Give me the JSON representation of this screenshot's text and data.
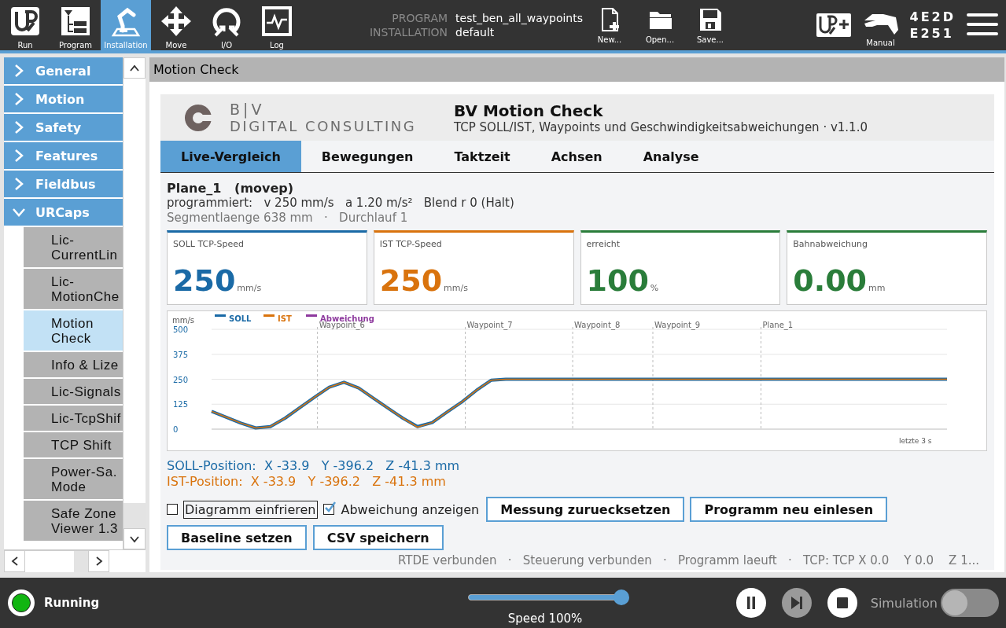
{
  "topbar": {
    "nav": [
      {
        "label": "Run",
        "selected": false
      },
      {
        "label": "Program",
        "selected": false
      },
      {
        "label": "Installation",
        "selected": true
      },
      {
        "label": "Move",
        "selected": false
      },
      {
        "label": "I/O",
        "selected": false
      },
      {
        "label": "Log",
        "selected": false
      }
    ],
    "program": {
      "label": "PROGRAM",
      "value": "test_ben_all_waypoints"
    },
    "installation": {
      "label": "INSTALLATION",
      "value": "default"
    },
    "file_actions": [
      "New...",
      "Open...",
      "Save..."
    ],
    "mode": {
      "label": "Manual"
    },
    "robot_code": [
      "4E2D",
      "E251"
    ]
  },
  "sidebar": {
    "items": [
      {
        "label": "General",
        "expanded": false
      },
      {
        "label": "Motion",
        "expanded": false
      },
      {
        "label": "Safety",
        "expanded": false
      },
      {
        "label": "Features",
        "expanded": false
      },
      {
        "label": "Fieldbus",
        "expanded": false
      },
      {
        "label": "URCaps",
        "expanded": true,
        "children": [
          {
            "label": "Lic-CurrentLin",
            "selected": false
          },
          {
            "label": "Lic-MotionChe",
            "selected": false
          },
          {
            "label": "Motion Check",
            "selected": true
          },
          {
            "label": "Info & Lize",
            "selected": false
          },
          {
            "label": "Lic-Signals",
            "selected": false
          },
          {
            "label": "Lic-TcpShif",
            "selected": false
          },
          {
            "label": "TCP Shift",
            "selected": false
          },
          {
            "label": "Power-Sa. Mode",
            "selected": false
          },
          {
            "label": "Safe Zone Viewer 1.3",
            "selected": false
          }
        ]
      }
    ]
  },
  "panel": {
    "title": "Motion Check"
  },
  "plugin": {
    "logo": {
      "line1": "B|V",
      "line2": "DIGITAL CONSULTING"
    },
    "title": "BV Motion Check",
    "subtitle": "TCP SOLL/IST, Waypoints und Geschwindigkeitsabweichungen · v1.1.0",
    "tabs": [
      {
        "label": "Live-Vergleich",
        "selected": true
      },
      {
        "label": "Bewegungen",
        "selected": false
      },
      {
        "label": "Taktzeit",
        "selected": false
      },
      {
        "label": "Achsen",
        "selected": false
      },
      {
        "label": "Analyse",
        "selected": false
      }
    ],
    "segment": {
      "name": "Plane_1",
      "type": "(movep)",
      "programmed": "programmiert:   v 250 mm/s   a 1.20 m/s²   Blend r 0 (Halt)",
      "info": "Segmentlaenge 638 mm   ·   Durchlauf 1"
    },
    "metrics": [
      {
        "label": "SOLL TCP-Speed",
        "value": "250",
        "unit": "mm/s",
        "color": "#1a6aa6"
      },
      {
        "label": "IST TCP-Speed",
        "value": "250",
        "unit": "mm/s",
        "color": "#d9730d"
      },
      {
        "label": "erreicht",
        "value": "100",
        "unit": "%",
        "color": "#2a7d3a"
      },
      {
        "label": "Bahnabweichung",
        "value": "0.00",
        "unit": "mm",
        "color": "#2a7d3a"
      }
    ],
    "chart": {
      "footnote": "letzte 3 s",
      "waypoints": [
        "Waypoint_6",
        "Waypoint_7",
        "Waypoint_8",
        "Waypoint_9",
        "Plane_1"
      ],
      "chart_data": {
        "type": "line",
        "ylabel": "mm/s",
        "categories": [
          null,
          null,
          null,
          null,
          null,
          null,
          null,
          null,
          null,
          null,
          null,
          null,
          null,
          null,
          null,
          null,
          null,
          null,
          null,
          null,
          null,
          null,
          null,
          null,
          null,
          null,
          null,
          null,
          null,
          null,
          null,
          null,
          null,
          null,
          null,
          null,
          null,
          null,
          null,
          null,
          null,
          null,
          null,
          null,
          null,
          null,
          null,
          null,
          null,
          null,
          null
        ],
        "ylim": [
          0,
          500
        ],
        "yticks": [
          0,
          125,
          250,
          375,
          500
        ],
        "grid": true,
        "legend": "top-left",
        "series": [
          {
            "name": "SOLL",
            "color": "#1a6aa6",
            "values": [
              89,
              60,
              30,
              6,
              13,
              55,
              108,
              160,
              210,
              235,
              206,
              155,
              105,
              55,
              13,
              33,
              85,
              135,
              194,
              245,
              250,
              250,
              250,
              250,
              250,
              250,
              250,
              250,
              250,
              250,
              250,
              250,
              250,
              250,
              250,
              250,
              250,
              250,
              250,
              250,
              250,
              250,
              250,
              250,
              250,
              250,
              250,
              250,
              250,
              250,
              250
            ]
          },
          {
            "name": "IST",
            "color": "#d9730d",
            "values": [
              89,
              60,
              30,
              6,
              13,
              55,
              108,
              160,
              210,
              235,
              206,
              155,
              105,
              55,
              10,
              33,
              85,
              135,
              194,
              245,
              250,
              250,
              250,
              250,
              250,
              250,
              250,
              250,
              250,
              250,
              250,
              250,
              250,
              250,
              250,
              250,
              250,
              250,
              250,
              250,
              250,
              250,
              250,
              250,
              250,
              250,
              250,
              250,
              250,
              250,
              250
            ]
          },
          {
            "name": "Abweichung",
            "color": "#8e3a9e",
            "values": [
              null,
              null,
              null,
              null,
              null,
              null,
              null,
              null,
              null,
              null,
              null,
              null,
              null,
              null,
              null,
              null,
              null,
              null,
              null,
              null,
              null,
              null,
              null,
              null,
              null,
              null,
              null,
              null,
              null,
              null,
              null,
              null,
              null,
              null,
              null,
              null,
              null,
              null,
              null,
              null,
              null,
              null,
              null,
              null,
              null,
              null,
              null,
              null,
              null,
              null,
              null
            ]
          }
        ]
      }
    },
    "positions": [
      {
        "label": "SOLL-Position:",
        "x": "X -33.9",
        "y": "Y -396.2",
        "z": "Z -41.3 mm",
        "color": "#1a6aa6"
      },
      {
        "label": "IST-Position:",
        "x": "X -33.9",
        "y": "Y -396.2",
        "z": "Z -41.3 mm",
        "color": "#d9730d"
      }
    ],
    "options": [
      {
        "label": "Diagramm einfrieren",
        "checked": false,
        "focused": true
      },
      {
        "label": "Abweichung anzeigen",
        "checked": true,
        "focused": false
      }
    ],
    "buttons": [
      "Messung zuruecksetzen",
      "Programm neu einlesen",
      "Baseline setzen",
      "CSV speichern"
    ],
    "status": "RTDE verbunden   ·   Steuerung verbunden   ·   Programm laeuft   ·   TCP: TCP X 0.0    Y 0.0    Z 1..."
  },
  "bottombar": {
    "status": {
      "label": "Running",
      "color": "#11b511"
    },
    "speed": {
      "level": 1.0,
      "label": "Speed 100%"
    },
    "controls": [
      {
        "kind": "pause",
        "disabled": false
      },
      {
        "kind": "step",
        "disabled": true
      },
      {
        "kind": "stop",
        "disabled": false
      }
    ],
    "simulation": {
      "label": "Simulation",
      "on": false
    }
  }
}
